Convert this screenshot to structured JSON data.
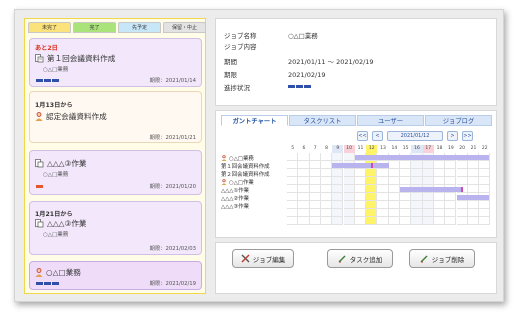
{
  "left_tabs": [
    {
      "label": "未完了",
      "color": "#fbe27a"
    },
    {
      "label": "完了",
      "color": "#a9e37a"
    },
    {
      "label": "先予定",
      "color": "#c7e6f7"
    },
    {
      "label": "保留・中止",
      "color": "#e3e3e3"
    }
  ],
  "cards": [
    {
      "due": "あと2日",
      "title": "第１回会議資料作成",
      "sub": "○△□業務",
      "date": "期限：2021/01/14",
      "progress": 3,
      "orange": false
    },
    {
      "due": "1月13日から",
      "title": "認定会議資料作成",
      "sub": "",
      "date": "期限：2021/01/21",
      "progress": 0,
      "orange": false
    },
    {
      "due": "",
      "title": "△△△③作業",
      "sub": "○△□業務",
      "date": "期限：2021/01/20",
      "progress": 1,
      "orange": true
    },
    {
      "due": "1月21日から",
      "title": "△△△③作業",
      "sub": "○△□業務",
      "date": "期限：2021/02/03",
      "progress": 0,
      "orange": false
    },
    {
      "due": "",
      "title": "○△□業務",
      "sub": "",
      "date": "期限：2021/02/19",
      "progress": 3,
      "orange": false
    }
  ],
  "job": {
    "name_label": "ジョブ名称",
    "name_value": "○△□業務",
    "content_label": "ジョブ内容",
    "period_label": "期間",
    "period_value": "2021/01/11 ～ 2021/02/19",
    "deadline_label": "期限",
    "deadline_value": "2021/02/19",
    "progress_label": "進捗状況",
    "progress": 3
  },
  "gantt_tabs": [
    "ガントチャート",
    "タスクリスト",
    "ユーザー",
    "ジョブログ"
  ],
  "nav": {
    "prev2": "<<",
    "prev": "<",
    "date": "2021/01/12",
    "next": ">",
    "next2": ">>"
  },
  "days": [
    "5",
    "6",
    "7",
    "8",
    "9",
    "10",
    "11",
    "12",
    "13",
    "14",
    "15",
    "16",
    "17",
    "18",
    "19",
    "20",
    "21",
    "22"
  ],
  "gantt_rows": [
    {
      "name": "○△□業務",
      "icon": "person-icon"
    },
    {
      "name": "第１回会議資料作成",
      "icon": ""
    },
    {
      "name": "第２回会議資料作成",
      "icon": ""
    },
    {
      "name": "○△□作業",
      "icon": "person-icon"
    },
    {
      "name": "△△△①作業",
      "icon": ""
    },
    {
      "name": "△△△②作業",
      "icon": ""
    },
    {
      "name": "△△△③作業",
      "icon": ""
    }
  ],
  "buttons": {
    "edit": "ジョブ編集",
    "add_task": "タスク追加",
    "delete": "ジョブ削除"
  },
  "colors": {
    "accent": "#2f4fa8",
    "gantt_bar": "#b9b4ee",
    "today": "#fff36a",
    "weekend": "#dde7f5",
    "holiday": "#f8d2d8"
  }
}
